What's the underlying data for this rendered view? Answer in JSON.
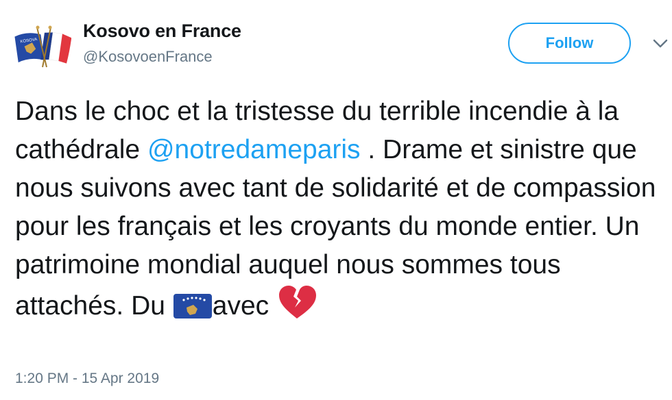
{
  "tweet": {
    "display_name": "Kosovo en France",
    "handle": "@KosovoenFrance",
    "follow_label": "Follow",
    "text": {
      "part1": "Dans le choc et la tristesse du terrible incendie à la cathédrale ",
      "mention": "@notredameparis",
      "part2": " . Drame et sinistre que nous suivons avec tant de solidarité et de compassion pour les français et les croyants du monde entier. Un patrimoine mondial auquel nous sommes tous attachés. Du ",
      "part3": "avec "
    },
    "emojis": [
      "flag-kosovo-icon",
      "broken-heart-icon"
    ],
    "timestamp": "1:20 PM - 15 Apr 2019",
    "avatar_text": "KOSOVA"
  },
  "colors": {
    "accent": "#1da1f2",
    "text": "#14171a",
    "secondary": "#657786",
    "kosovo_blue": "#244aa5",
    "kosovo_gold": "#d0a650",
    "heart_red": "#dd2e44"
  }
}
